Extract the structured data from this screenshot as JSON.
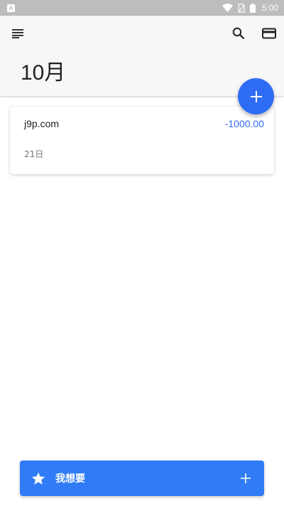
{
  "status_bar": {
    "time": "5:00",
    "notification_icon": "android-notification-icon",
    "icons": [
      "wifi-icon",
      "no-sim-icon",
      "battery-icon"
    ]
  },
  "header": {
    "menu_icon": "menu-lines-icon",
    "search_icon": "search-icon",
    "card_icon": "credit-card-icon",
    "month_title": "10月"
  },
  "fab": {
    "icon": "plus-icon"
  },
  "transactions": [
    {
      "name": "j9p.com",
      "amount": "-1000.00",
      "date": "21日"
    }
  ],
  "wishlist": {
    "label": "我想要",
    "star_icon": "star-icon",
    "add_icon": "plus-icon"
  },
  "colors": {
    "accent": "#2f6cf6",
    "wish_bar": "#2f7cf6",
    "header_bg": "#f7f7f7",
    "status_bar": "#bdbdbd"
  }
}
